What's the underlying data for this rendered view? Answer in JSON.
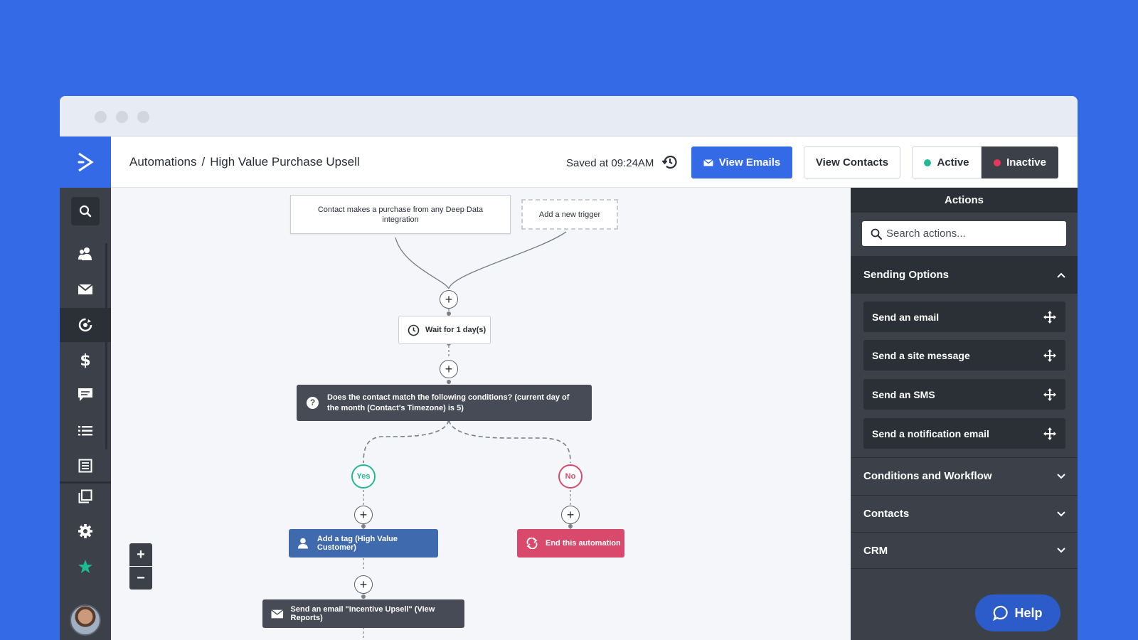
{
  "header": {
    "breadcrumb_root": "Automations",
    "breadcrumb_sep": "/",
    "breadcrumb_current": "High Value Purchase Upsell",
    "saved_text": "Saved at 09:24AM",
    "view_emails_label": "View Emails",
    "view_contacts_label": "View Contacts",
    "active_label": "Active",
    "inactive_label": "Inactive"
  },
  "colors": {
    "brand_blue": "#356ae6",
    "active_green": "#1fb993",
    "inactive_red": "#e8365d",
    "tag_blue": "#3f6aad",
    "end_pink": "#d9496b"
  },
  "sidebar": {
    "items": [
      {
        "icon": "search-icon"
      },
      {
        "icon": "contacts-icon"
      },
      {
        "icon": "envelope-icon"
      },
      {
        "icon": "automation-icon"
      },
      {
        "icon": "dollar-icon"
      },
      {
        "icon": "chat-icon"
      },
      {
        "icon": "list-icon"
      },
      {
        "icon": "form-icon"
      },
      {
        "icon": "pages-icon"
      },
      {
        "icon": "gear-icon"
      },
      {
        "icon": "star-icon"
      }
    ]
  },
  "flow": {
    "trigger_text": "Contact makes a purchase from any Deep Data integration",
    "new_trigger_text": "Add a new trigger",
    "wait_text": "Wait for 1 day(s)",
    "condition_text": "Does the contact match the following conditions? (current day of the month (Contact's Timezone) is 5)",
    "yes_label": "Yes",
    "no_label": "No",
    "tag_text": "Add a tag (High Value Customer)",
    "end_text": "End this automation",
    "email_text": "Send an email \"Incentive Upsell\" (View Reports)",
    "plus_symbol": "+",
    "zoom_in": "+",
    "zoom_out": "−"
  },
  "panel": {
    "title": "Actions",
    "search_placeholder": "Search actions...",
    "open_section": "Sending Options",
    "actions": [
      {
        "label": "Send an email"
      },
      {
        "label": "Send a site message"
      },
      {
        "label": "Send an SMS"
      },
      {
        "label": "Send a notification email"
      }
    ],
    "sections": [
      {
        "label": "Conditions and Workflow"
      },
      {
        "label": "Contacts"
      },
      {
        "label": "CRM"
      }
    ]
  },
  "help_label": "Help"
}
